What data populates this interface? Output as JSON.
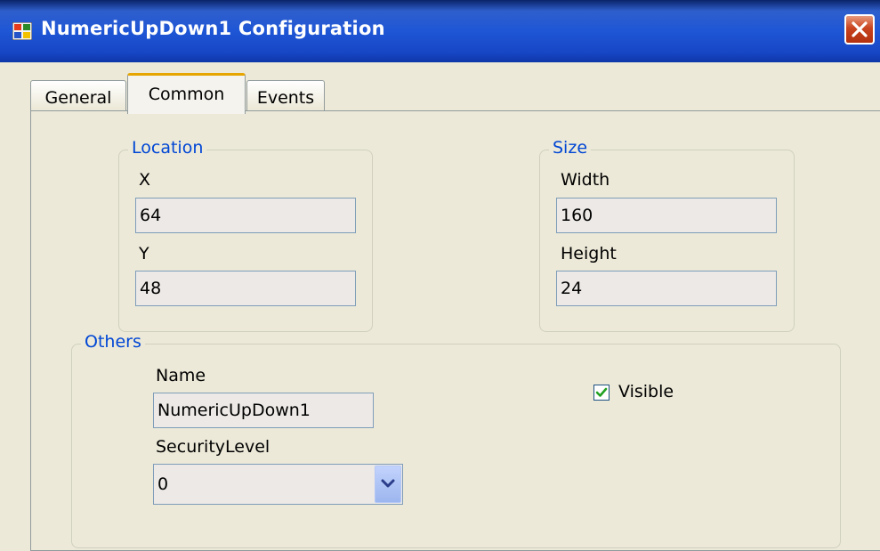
{
  "window": {
    "title": "NumericUpDown1 Configuration"
  },
  "tabs": [
    {
      "label": "General",
      "active": false
    },
    {
      "label": "Common",
      "active": true
    },
    {
      "label": "Events",
      "active": false
    }
  ],
  "location": {
    "legend": "Location",
    "x_label": "X",
    "x_value": "64",
    "y_label": "Y",
    "y_value": "48"
  },
  "size": {
    "legend": "Size",
    "width_label": "Width",
    "width_value": "160",
    "height_label": "Height",
    "height_value": "24"
  },
  "others": {
    "legend": "Others",
    "name_label": "Name",
    "name_value": "NumericUpDown1",
    "security_label": "SecurityLevel",
    "security_value": "0",
    "visible_label": "Visible",
    "visible_checked": true
  },
  "colors": {
    "accent": "#0046d5",
    "titlebar": "#1e56d6",
    "close": "#c9431f"
  },
  "icons": {
    "app": "app-icon",
    "close": "close-icon",
    "dropdown": "chevron-down-icon",
    "check": "check-icon"
  }
}
